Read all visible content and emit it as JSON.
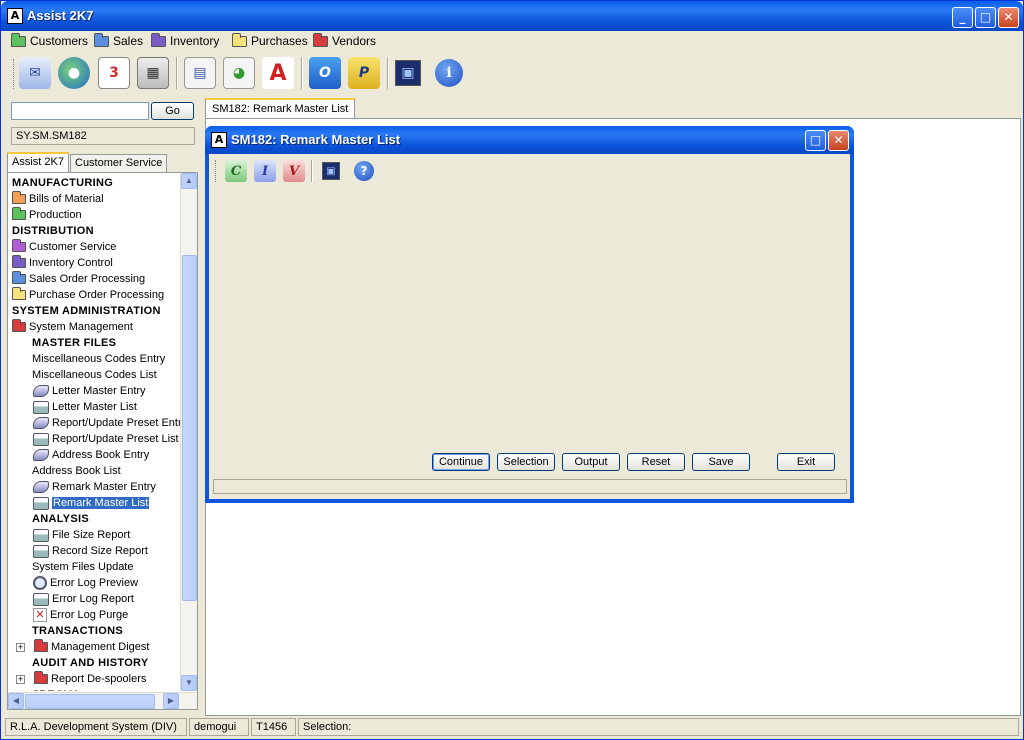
{
  "window": {
    "title": "Assist 2K7",
    "app_glyph": "A"
  },
  "title_buttons": {
    "minimize": "_",
    "maximize": "□",
    "close": "✕"
  },
  "menubar": [
    {
      "label": "Customers",
      "icon": "folder-green-icon",
      "color": "#5cc25c"
    },
    {
      "label": "Sales",
      "icon": "folder-blue-icon",
      "color": "#5a8fe0"
    },
    {
      "label": "Inventory",
      "icon": "folder-purple-icon",
      "color": "#7b5cc7"
    },
    {
      "label": "Purchases",
      "icon": "folder-yellow-icon",
      "color": "#f5e27a"
    },
    {
      "label": "Vendors",
      "icon": "folder-red-icon",
      "color": "#d83b3b"
    }
  ],
  "toolbar": [
    {
      "name": "mail-icon",
      "glyph": "✉"
    },
    {
      "name": "globe-icon",
      "glyph": "●"
    },
    {
      "name": "calendar-icon",
      "glyph": "3"
    },
    {
      "name": "calculator-icon",
      "glyph": "▦"
    },
    {
      "name": "notepad-icon",
      "glyph": "▤"
    },
    {
      "name": "report-chart-icon",
      "glyph": "◕"
    },
    {
      "name": "acrobat-icon",
      "glyph": "A"
    },
    {
      "name": "outlook-icon",
      "glyph": "O"
    },
    {
      "name": "publisher-icon",
      "glyph": "P"
    },
    {
      "name": "picture-icon",
      "glyph": "▣"
    },
    {
      "name": "info-icon",
      "glyph": "i"
    }
  ],
  "left": {
    "search_value": "",
    "go_label": "Go",
    "path": "SY.SM.SM182",
    "tabs": [
      "Assist 2K7",
      "Customer Service"
    ]
  },
  "tree": [
    {
      "label": "MANUFACTURING",
      "type": "header",
      "indent": 0
    },
    {
      "label": "Bills of Material",
      "type": "folder",
      "color": "#f0a050",
      "indent": 0
    },
    {
      "label": "Production",
      "type": "folder",
      "color": "#5cc25c",
      "indent": 0
    },
    {
      "label": "DISTRIBUTION",
      "type": "header",
      "indent": 0
    },
    {
      "label": "Customer Service",
      "type": "folder",
      "color": "#b25cd6",
      "indent": 0
    },
    {
      "label": "Inventory Control",
      "type": "folder",
      "color": "#7b5cc7",
      "indent": 0
    },
    {
      "label": "Sales Order Processing",
      "type": "folder",
      "color": "#5a8fe0",
      "indent": 0
    },
    {
      "label": "Purchase Order Processing",
      "type": "folder",
      "color": "#f5e27a",
      "indent": 0
    },
    {
      "label": "SYSTEM ADMINISTRATION",
      "type": "header",
      "indent": 0
    },
    {
      "label": "System Management",
      "type": "folder",
      "color": "#d83b3b",
      "indent": 0
    },
    {
      "label": "MASTER FILES",
      "type": "header",
      "indent": 1
    },
    {
      "label": "Miscellaneous Codes Entry",
      "type": "text",
      "indent": 1
    },
    {
      "label": "Miscellaneous Codes List",
      "type": "text",
      "indent": 1
    },
    {
      "label": "Letter Master Entry",
      "type": "entry",
      "indent": 2
    },
    {
      "label": "Letter Master List",
      "type": "print",
      "indent": 2
    },
    {
      "label": "Report/Update Preset Entr",
      "type": "entry",
      "indent": 2
    },
    {
      "label": "Report/Update Preset List",
      "type": "print",
      "indent": 2
    },
    {
      "label": "Address Book Entry",
      "type": "entry",
      "indent": 2
    },
    {
      "label": "Address Book List",
      "type": "text",
      "indent": 1
    },
    {
      "label": "Remark Master Entry",
      "type": "entry",
      "indent": 2
    },
    {
      "label": "Remark Master List",
      "type": "print",
      "indent": 2,
      "selected": true
    },
    {
      "label": "ANALYSIS",
      "type": "header",
      "indent": 1
    },
    {
      "label": "File Size Report",
      "type": "print",
      "indent": 2
    },
    {
      "label": "Record Size Report",
      "type": "print",
      "indent": 2
    },
    {
      "label": "System Files Update",
      "type": "text",
      "indent": 1
    },
    {
      "label": "Error Log Preview",
      "type": "preview",
      "indent": 2
    },
    {
      "label": "Error Log Report",
      "type": "print",
      "indent": 2
    },
    {
      "label": "Error Log Purge",
      "type": "purge",
      "indent": 2
    },
    {
      "label": "TRANSACTIONS",
      "type": "header",
      "indent": 1
    },
    {
      "label": "Management Digest",
      "type": "expand-folder",
      "color": "#d83b3b",
      "indent": 2
    },
    {
      "label": "AUDIT AND HISTORY",
      "type": "header",
      "indent": 1
    },
    {
      "label": "Report De-spoolers",
      "type": "expand-folder",
      "color": "#d83b3b",
      "indent": 2
    },
    {
      "label": "SPECIAL",
      "type": "header",
      "indent": 1
    }
  ],
  "main_tab": "SM182: Remark Master List",
  "dialog": {
    "title": "SM182: Remark Master List",
    "tools": [
      {
        "name": "continue-icon",
        "glyph": "C",
        "color": "#2e9b2e"
      },
      {
        "name": "inquiry-icon",
        "glyph": "I",
        "color": "#3d5fcf"
      },
      {
        "name": "view-icon",
        "glyph": "V",
        "color": "#c43030"
      },
      {
        "name": "picture-icon",
        "glyph": "▣",
        "color": "#1b2e6b"
      },
      {
        "name": "help-icon",
        "glyph": "?",
        "color": "#1f5fd8"
      }
    ],
    "buttons": {
      "continue": "Continue",
      "selection": "Selection",
      "output": "Output",
      "reset": "Reset",
      "save": "Save",
      "exit": "Exit"
    }
  },
  "status": {
    "system": "R.L.A. Development System (DIV)",
    "user": "demogui",
    "terminal": "T1456",
    "selection": "Selection:"
  }
}
